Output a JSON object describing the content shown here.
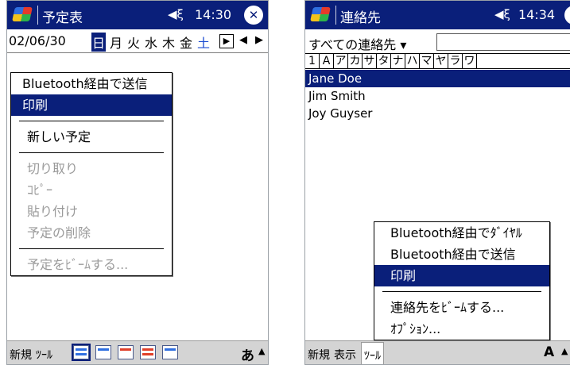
{
  "left": {
    "title": "予定表",
    "time": "14:30",
    "date": "02/06/30",
    "days": [
      "日",
      "月",
      "火",
      "水",
      "木",
      "金",
      "土"
    ],
    "menu": {
      "send_bt": "Bluetooth経由で送信",
      "print": "印刷",
      "new": "新しい予定",
      "cut": "切り取り",
      "copy": "ｺﾋﾟｰ",
      "paste": "貼り付け",
      "delete": "予定の削除",
      "beam": "予定をﾋﾞｰﾑする..."
    },
    "bottom": {
      "new": "新規",
      "tools": "ﾂｰﾙ",
      "ime": "あ"
    }
  },
  "right": {
    "title": "連絡先",
    "time": "14:34",
    "filter": "すべての連絡先 ▾",
    "tabs": [
      "1",
      "A",
      "ア",
      "カ",
      "サ",
      "タ",
      "ナ",
      "ハ",
      "マ",
      "ヤ",
      "ラ",
      "ワ"
    ],
    "contacts": [
      "Jane Doe",
      "Jim Smith",
      "Joy Guyser"
    ],
    "menu": {
      "dial_bt": "Bluetooth経由でﾀﾞｲﾔﾙ",
      "send_bt": "Bluetooth経由で送信",
      "print": "印刷",
      "beam": "連絡先をﾋﾞｰﾑする...",
      "options": "ｵﾌﾟｼｮﾝ..."
    },
    "bottom": {
      "new": "新規",
      "view": "表示",
      "tools": "ﾂｰﾙ",
      "ime": "A"
    }
  },
  "icons": {
    "start": "windows-flag-icon",
    "speaker": "speaker-icon",
    "close": "close-icon"
  },
  "colors": {
    "titlebar": "#0a1f7a",
    "highlight": "#0a1f7a",
    "disabled": "#9a9a9a",
    "saturday": "#1a4ad0"
  }
}
